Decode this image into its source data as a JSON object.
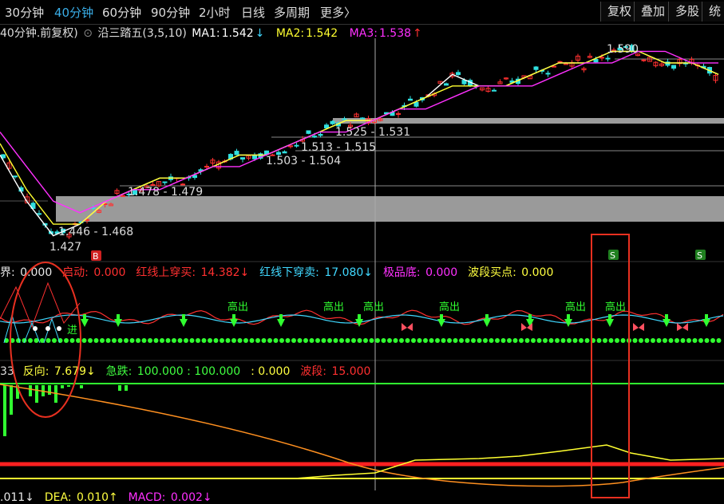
{
  "toolbar": {
    "periods": [
      "30分钟",
      "40分钟",
      "60分钟",
      "90分钟",
      "2小时",
      "日线",
      "多周期",
      "更多〉"
    ],
    "active_period": "40分钟",
    "right_buttons": [
      "复权",
      "叠加",
      "多股",
      "统"
    ]
  },
  "panel1": {
    "title": "40分钟.前复权)",
    "indicator": "沿三踏五(3,5,10)",
    "ma1_label": "MA1:",
    "ma1_value": "1.542",
    "ma1_arrow": "↓",
    "ma2_label": "MA2:",
    "ma2_value": "1.542",
    "ma3_label": "MA3:",
    "ma3_value": "1.538",
    "ma3_arrow": "↑",
    "price_labels": [
      "1.590",
      "1.525 - 1.531",
      "1.513 - 1.515",
      "1.503 - 1.504",
      "1.478 - 1.479",
      "1.446 - 1.468",
      "1.427"
    ],
    "signals": [
      "B",
      "S",
      "S"
    ]
  },
  "panel2": {
    "items": [
      {
        "label": "界:",
        "value": "0.000",
        "color": "#e8e8e8"
      },
      {
        "label": "启动:",
        "value": "0.000",
        "color": "#ff3030"
      },
      {
        "label": "红线上穿买:",
        "value": "14.382↓",
        "color": "#ff3030"
      },
      {
        "label": "红线下穿卖:",
        "value": "17.080↓",
        "color": "#40d8ff"
      },
      {
        "label": "极品底:",
        "value": "0.000",
        "color": "#ff30ff"
      },
      {
        "label": "波段买点:",
        "value": "0.000",
        "color": "#ffff40"
      }
    ],
    "marker_text": "高出",
    "partial_text": "进"
  },
  "panel3": {
    "prefix": "33",
    "items": [
      {
        "label": "反向:",
        "value": "7.679↓",
        "color": "#ffff40"
      },
      {
        "label": "急跌:",
        "value": "100.000 : 100.000",
        "color": "#40ff40"
      },
      {
        "label": "",
        "value": ": 0.000",
        "color": "#ffff40"
      },
      {
        "label": "波段:",
        "value": "15.000",
        "color": "#ff3030"
      }
    ]
  },
  "panel4": {
    "items": [
      {
        "label": ".011↓",
        "value": "",
        "color": "#e8e8e8"
      },
      {
        "label": "DEA:",
        "value": "0.010↑",
        "color": "#ffff40"
      },
      {
        "label": "MACD:",
        "value": "0.002↓",
        "color": "#ff30ff"
      }
    ]
  },
  "colors": {
    "ma1": "#ffffff",
    "ma2": "#ffff30",
    "ma3": "#ff30ff",
    "up": "#ff3030",
    "down": "#30e0e0",
    "zone": "#9a9a9a",
    "highlight": "#e83020"
  },
  "chart_data": {
    "type": "line",
    "title": "沿三踏五(3,5,10)",
    "series": [
      {
        "name": "MA1",
        "values": [
          1.5,
          1.46,
          1.43,
          1.44,
          1.46,
          1.47,
          1.48,
          1.48,
          1.49,
          1.5,
          1.5,
          1.51,
          1.52,
          1.53,
          1.53,
          1.54,
          1.55,
          1.57,
          1.56,
          1.56,
          1.57,
          1.58,
          1.58,
          1.59,
          1.59,
          1.58,
          1.58,
          1.57
        ]
      },
      {
        "name": "MA2",
        "values": [
          1.51,
          1.47,
          1.44,
          1.44,
          1.46,
          1.47,
          1.48,
          1.48,
          1.49,
          1.5,
          1.5,
          1.51,
          1.52,
          1.53,
          1.53,
          1.54,
          1.55,
          1.56,
          1.56,
          1.56,
          1.57,
          1.58,
          1.58,
          1.59,
          1.59,
          1.58,
          1.58,
          1.57
        ]
      },
      {
        "name": "MA3",
        "values": [
          1.52,
          1.49,
          1.46,
          1.45,
          1.46,
          1.47,
          1.47,
          1.48,
          1.49,
          1.49,
          1.5,
          1.51,
          1.52,
          1.52,
          1.53,
          1.54,
          1.54,
          1.55,
          1.56,
          1.56,
          1.56,
          1.57,
          1.58,
          1.58,
          1.59,
          1.59,
          1.58,
          1.58
        ]
      }
    ],
    "ylim": [
      1.42,
      1.6
    ],
    "legend": "top-left"
  }
}
